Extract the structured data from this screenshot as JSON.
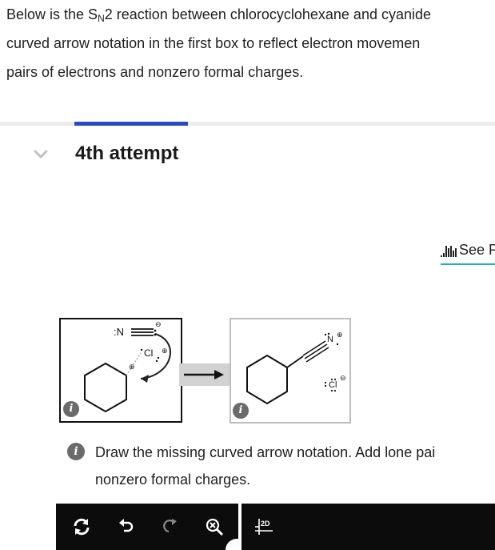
{
  "question": {
    "line1_pre": "Below is the S",
    "line1_sub": "N",
    "line1_post": "2 reaction between chlorocyclohexane and cyanide",
    "line2": "curved arrow notation in the first box to reflect electron movemen",
    "line3": "pairs of electrons and nonzero formal charges."
  },
  "attempt": {
    "title": "4th attempt"
  },
  "periodic_table_link": {
    "label": "See Per"
  },
  "reactant_box": {
    "cyanide_n": ":N",
    "chloride": "Cl",
    "charge_minus": "⊖",
    "charge_plus": "⊕",
    "info": "i"
  },
  "product_box": {
    "nitrogen": "N",
    "chloride": "Cl",
    "charge_minus": "⊖",
    "charge_plus": "⊕",
    "info": "i"
  },
  "hint": {
    "info": "i",
    "line1": "Draw the missing curved arrow notation. Add lone pai",
    "line2": "nonzero formal charges."
  },
  "toolbar": {
    "buttons": [
      "reset-icon",
      "undo-icon",
      "redo-icon",
      "zoom-clear-icon",
      "2d-icon"
    ],
    "label_2d": "2D"
  },
  "colors": {
    "accent_blue": "#2a49c8",
    "underline_teal": "#2aa9c9",
    "toolbar_bg": "#0c0c0c"
  }
}
